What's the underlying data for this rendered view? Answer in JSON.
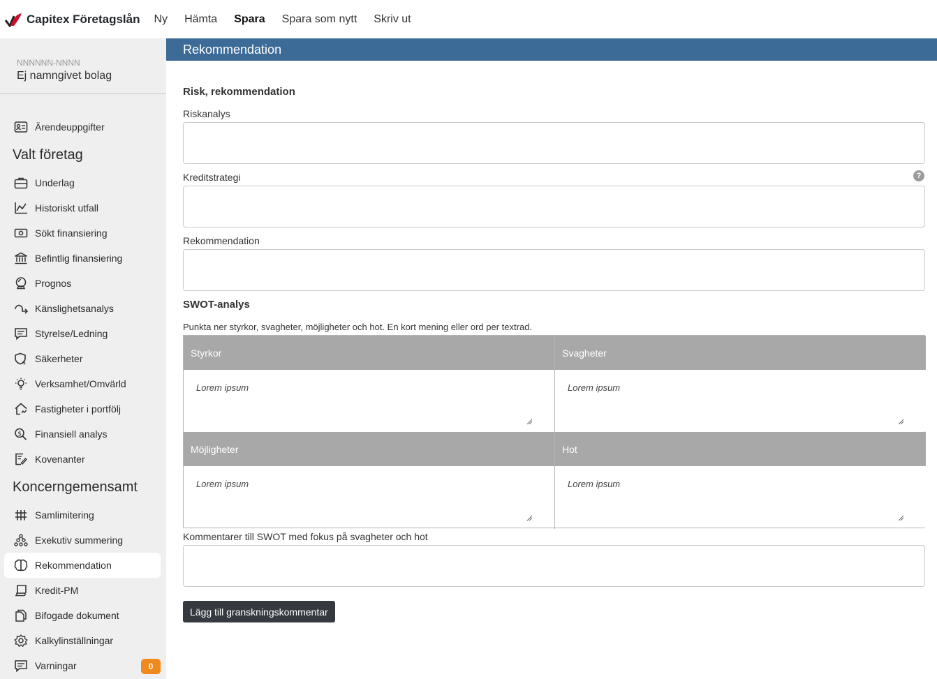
{
  "app": {
    "title": "Capitex Företagslån"
  },
  "menu": {
    "new": "Ny",
    "fetch": "Hämta",
    "save": "Spara",
    "save_as_new": "Spara som nytt",
    "print": "Skriv ut"
  },
  "company": {
    "org_number": "NNNNNN-NNNN",
    "name": "Ej namngivet bolag"
  },
  "sidebar": {
    "case_info": "Ärendeuppgifter",
    "section_selected": "Valt företag",
    "items_selected": [
      {
        "label": "Underlag",
        "icon": "briefcase-icon"
      },
      {
        "label": "Historiskt utfall",
        "icon": "chart-line-icon"
      },
      {
        "label": "Sökt finansiering",
        "icon": "money-icon"
      },
      {
        "label": "Befintlig finansiering",
        "icon": "bank-icon"
      },
      {
        "label": "Prognos",
        "icon": "crystal-ball-icon"
      },
      {
        "label": "Känslighetsanalys",
        "icon": "trend-arrow-icon"
      },
      {
        "label": "Styrelse/Ledning",
        "icon": "comment-icon"
      },
      {
        "label": "Säkerheter",
        "icon": "shield-dollar-icon"
      },
      {
        "label": "Verksamhet/Omvärld",
        "icon": "lightbulb-icon"
      },
      {
        "label": "Fastigheter i portfölj",
        "icon": "house-icon"
      },
      {
        "label": "Finansiell analys",
        "icon": "search-dollar-icon"
      },
      {
        "label": "Kovenanter",
        "icon": "document-edit-icon"
      }
    ],
    "section_group": "Koncerngemensamt",
    "items_group": [
      {
        "label": "Samlimitering",
        "icon": "limit-icon"
      },
      {
        "label": "Exekutiv summering",
        "icon": "hierarchy-icon"
      },
      {
        "label": "Rekommendation",
        "icon": "brain-icon"
      },
      {
        "label": "Kredit-PM",
        "icon": "scroll-icon"
      },
      {
        "label": "Bifogade dokument",
        "icon": "documents-icon"
      },
      {
        "label": "Kalkylinställningar",
        "icon": "settings-icon"
      },
      {
        "label": "Varningar",
        "icon": "warning-comment-icon"
      }
    ],
    "warnings_count": "0"
  },
  "main": {
    "header": "Rekommendation",
    "risk_heading": "Risk, rekommendation",
    "risk_analysis_label": "Riskanalys",
    "credit_strategy_label": "Kreditstrategi",
    "help_label": "?",
    "recommendation_label": "Rekommendation",
    "swot_heading": "SWOT-analys",
    "swot_description": "Punkta ner styrkor, svagheter, möjligheter och hot. En kort mening eller ord per textrad.",
    "swot": {
      "strengths": "Styrkor",
      "weaknesses": "Svagheter",
      "opportunities": "Möjligheter",
      "threats": "Hot",
      "placeholder": "Lorem ipsum"
    },
    "comments_label": "Kommentarer till SWOT med fokus på svagheter och hot",
    "add_comment_button": "Lägg till granskningskommentar"
  },
  "colors": {
    "header_bar": "#3d6b98",
    "sidebar_bg": "#efefef",
    "swot_header": "#a8a8a8",
    "badge": "#f08a1e",
    "button": "#343a40",
    "brand_red": "#c8102e"
  }
}
